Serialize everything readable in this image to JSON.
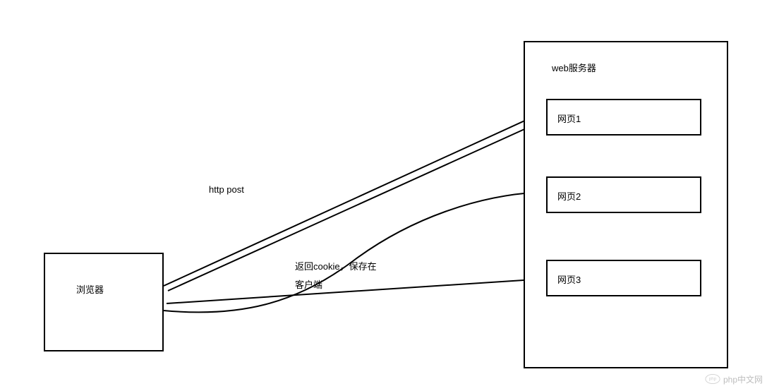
{
  "browser": {
    "label": "浏览器"
  },
  "server": {
    "title": "web服务器",
    "pages": [
      {
        "label": "网页1"
      },
      {
        "label": "网页2"
      },
      {
        "label": "网页3"
      }
    ]
  },
  "labels": {
    "http_post": "http post",
    "cookie_line1": "返回cookie，保存在",
    "cookie_line2": "客户端"
  },
  "watermark": "php中文网"
}
